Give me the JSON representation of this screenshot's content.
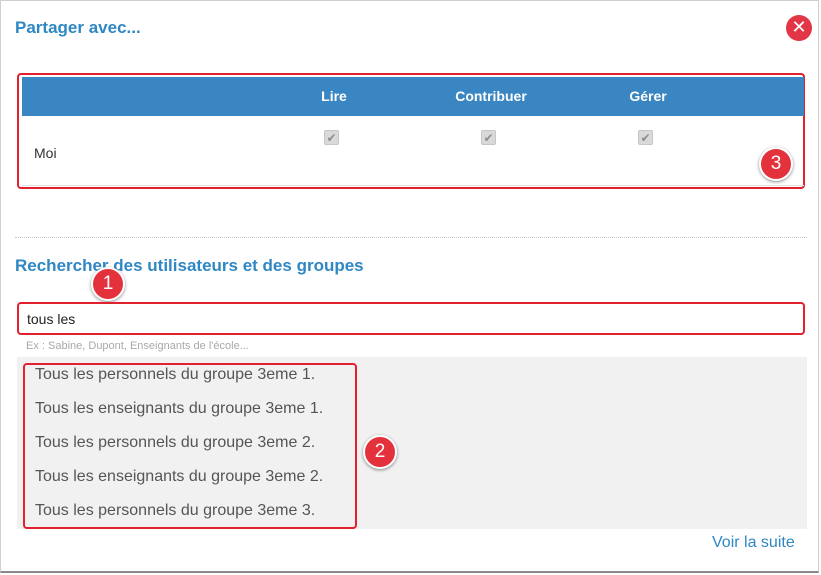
{
  "dialog": {
    "title": "Partager avec...",
    "close_icon": "close-icon"
  },
  "permissions": {
    "columns": [
      "Lire",
      "Contribuer",
      "Gérer"
    ],
    "rows": [
      {
        "name": "Moi",
        "checked": [
          true,
          true,
          true
        ]
      }
    ]
  },
  "search": {
    "heading": "Rechercher des utilisateurs et des groupes",
    "value": "tous les ",
    "hint": "Ex : Sabine, Dupont, Enseignants de l'école..."
  },
  "results": [
    "Tous les personnels du groupe 3eme 1.",
    "Tous les enseignants du groupe 3eme 1.",
    "Tous les personnels du groupe 3eme 2.",
    "Tous les enseignants du groupe 3eme 2.",
    "Tous les personnels du groupe 3eme 3."
  ],
  "more_link": "Voir la suite",
  "annotations": {
    "badge_1": "1",
    "badge_2": "2",
    "badge_3": "3",
    "color": "#e4323c"
  },
  "colors": {
    "accent": "#2f87c3",
    "table_header": "#3a86c2",
    "close": "#e23545"
  }
}
